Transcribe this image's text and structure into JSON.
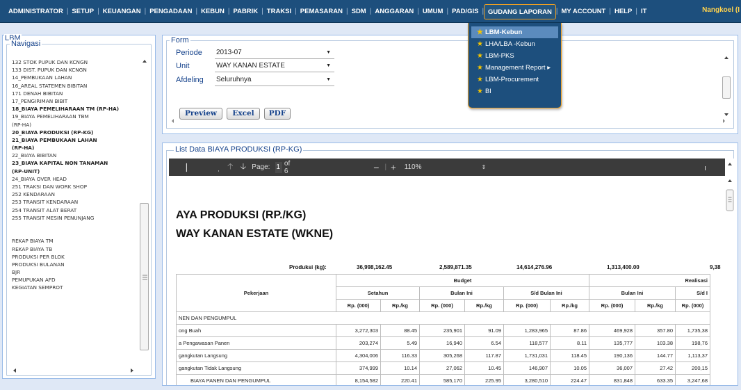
{
  "menu": {
    "items": [
      "ADMINISTRATOR",
      "SETUP",
      "KEUANGAN",
      "PENGADAAN",
      "KEBUN",
      "PABRIK",
      "TRAKSI",
      "PEMASARAN",
      "SDM",
      "ANGGARAN",
      "UMUM",
      "PAD/GIS",
      "GUDANG LAPORAN",
      "MY ACCOUNT",
      "HELP",
      "IT"
    ],
    "active": "GUDANG LAPORAN",
    "user": "Nangkoel (I"
  },
  "dropdown": {
    "items": [
      "LBM-Kebun",
      "LHA/LBA -Kebun",
      "LBM-PKS",
      "Management Report ▸",
      "LBM-Procurement",
      "BI"
    ],
    "highlighted": "LBM-Kebun"
  },
  "lbm": {
    "title": "LBM",
    "nav_legend": "Navigasi",
    "items": [
      {
        "label": "132 STOK PUPUK DAN KCNGN",
        "bold": false
      },
      {
        "label": "133 DIST. PUPUK DAN KCNGN",
        "bold": false
      },
      {
        "label": "14_PEMBUKAAN LAHAN",
        "bold": false
      },
      {
        "label": "16_AREAL STATEMEN BIBITAN",
        "bold": false
      },
      {
        "label": "171 DENAH BIBITAN",
        "bold": false
      },
      {
        "label": "17_PENGIRIMAN BIBIT",
        "bold": false
      },
      {
        "label": "18_BIAYA PEMELIHARAAN TM (RP-HA)",
        "bold": true
      },
      {
        "label": "19_BIAYA PEMELIHARAAN TBM",
        "bold": false
      },
      {
        "label": "(RP-HA)",
        "bold": false
      },
      {
        "label": "20_BIAYA PRODUKSI (RP-KG)",
        "bold": true
      },
      {
        "label": "21_BIAYA PEMBUKAAN LAHAN",
        "bold": true
      },
      {
        "label": "(RP-HA)",
        "bold": true
      },
      {
        "label": "22_BIAYA BIBITAN",
        "bold": false
      },
      {
        "label": "23_BIAYA KAPITAL NON TANAMAN",
        "bold": true
      },
      {
        "label": "(RP-UNIT)",
        "bold": true
      },
      {
        "label": "24_BIAYA OVER HEAD",
        "bold": false
      },
      {
        "label": "251 TRAKSI DAN WORK SHOP",
        "bold": false
      },
      {
        "label": "252 KENDARAAN",
        "bold": false
      },
      {
        "label": "253 TRANSIT KENDARAAN",
        "bold": false
      },
      {
        "label": "254 TRANSIT ALAT BERAT",
        "bold": false
      },
      {
        "label": "255 TRANSIT MESIN PENUNJANG",
        "bold": false
      },
      {
        "label": "",
        "bold": false
      },
      {
        "label": "",
        "bold": false
      },
      {
        "label": "REKAP BIAYA TM",
        "bold": false
      },
      {
        "label": "REKAP BIAYA TB",
        "bold": false
      },
      {
        "label": "PRODUKSI PER BLOK",
        "bold": false
      },
      {
        "label": "PRODUKSI BULANAN",
        "bold": false
      },
      {
        "label": "BJR",
        "bold": false
      },
      {
        "label": "PEMUPUKAN AFD",
        "bold": false
      },
      {
        "label": "KEGIATAN SEMPROT",
        "bold": false
      }
    ]
  },
  "form": {
    "legend": "Form",
    "periode_label": "Periode",
    "periode_value": "2013-07",
    "unit_label": "Unit",
    "unit_value": "WAY KANAN ESTATE",
    "afdeling_label": "Afdeling",
    "afdeling_value": "Seluruhnya",
    "btn_preview": "Preview",
    "btn_excel": "Excel",
    "btn_pdf": "PDF"
  },
  "list": {
    "legend": "List Data BIAYA PRODUKSI (RP-KG)",
    "pdf": {
      "page_label": "Page:",
      "page_current": "1",
      "page_total": "of 6",
      "zoom": "110%",
      "title_line1": "AYA PRODUKSI (RP./KG)",
      "title_line2": "WAY KANAN ESTATE (WKNE)",
      "produksi_label": "Produksi (kg):",
      "produksi_values": [
        "36,998,162.45",
        "2,589,871.35",
        "14,614,276.96",
        "1,313,400.00",
        "9,38"
      ],
      "budget_header": "Budget",
      "realisasi_header": "Realisasi",
      "pekerjaan_header": "Pekerjaan",
      "sub_headers": [
        "Setahun",
        "Bulan Ini",
        "S/d Bulan Ini",
        "Bulan Ini",
        "S/d I"
      ],
      "col_headers": [
        "Rp. (000)",
        "Rp./kg",
        "Rp. (000)",
        "Rp./kg",
        "Rp. (000)",
        "Rp./kg",
        "Rp. (000)",
        "Rp./kg",
        "Rp. (000)"
      ],
      "section": "NEN DAN PENGUMPUL",
      "rows": [
        {
          "name": "ong Buah",
          "values": [
            "3,272,303",
            "88.45",
            "235,901",
            "91.09",
            "1,283,965",
            "87.86",
            "469,928",
            "357.80",
            "1,735,38"
          ]
        },
        {
          "name": "a Pengawasan Panen",
          "values": [
            "203,274",
            "5.49",
            "16,940",
            "6.54",
            "118,577",
            "8.11",
            "135,777",
            "103.38",
            "198,76"
          ]
        },
        {
          "name": "gangkutan Langsung",
          "values": [
            "4,304,006",
            "116.33",
            "305,268",
            "117.87",
            "1,731,031",
            "118.45",
            "190,136",
            "144.77",
            "1,113,37"
          ]
        },
        {
          "name": "gangkutan Tidak Langsung",
          "values": [
            "374,999",
            "10.14",
            "27,062",
            "10.45",
            "146,907",
            "10.05",
            "36,007",
            "27.42",
            "200,15"
          ]
        },
        {
          "name": "BIAYA PANEN DAN PENGUMPUL",
          "values": [
            "8,154,582",
            "220.41",
            "585,170",
            "225.95",
            "3,280,510",
            "224.47",
            "831,848",
            "633.35",
            "3,247,68"
          ]
        }
      ]
    }
  }
}
